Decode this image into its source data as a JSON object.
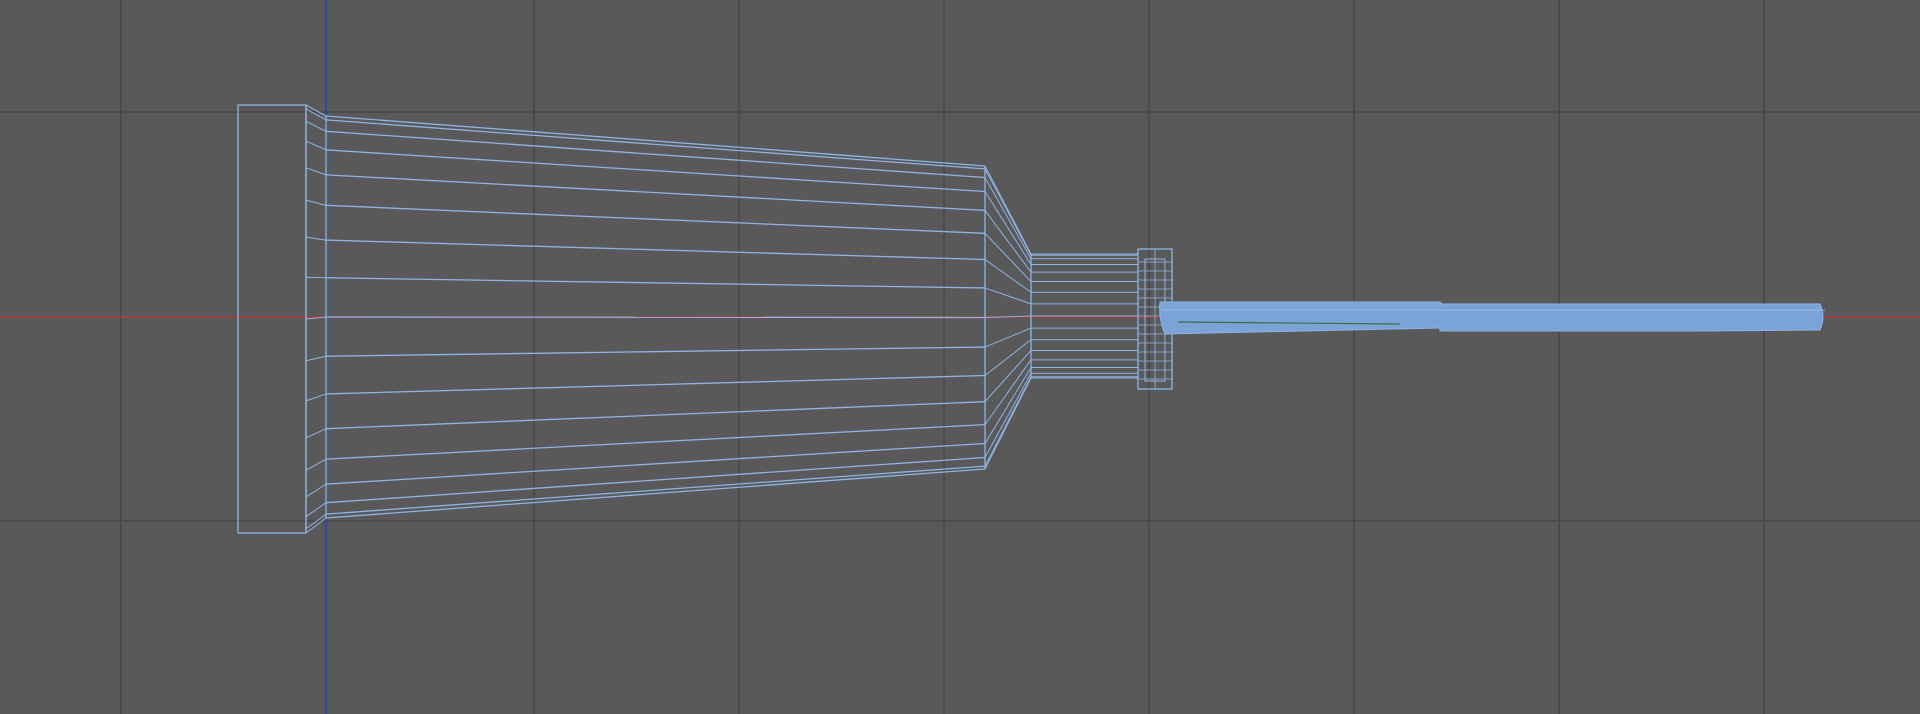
{
  "viewport": {
    "view": "side",
    "mode": "wireframe",
    "grid": true,
    "object": "wireframe-mesh"
  },
  "colors": {
    "background": "#595959",
    "grid": "#474747",
    "x_axis": "#b03a3a",
    "y_axis": "#2f3fb8",
    "wire": "#8fb4e6",
    "wire_selected": "#7aa3d8",
    "wire_dark": "#3f6f3f"
  },
  "icons": []
}
